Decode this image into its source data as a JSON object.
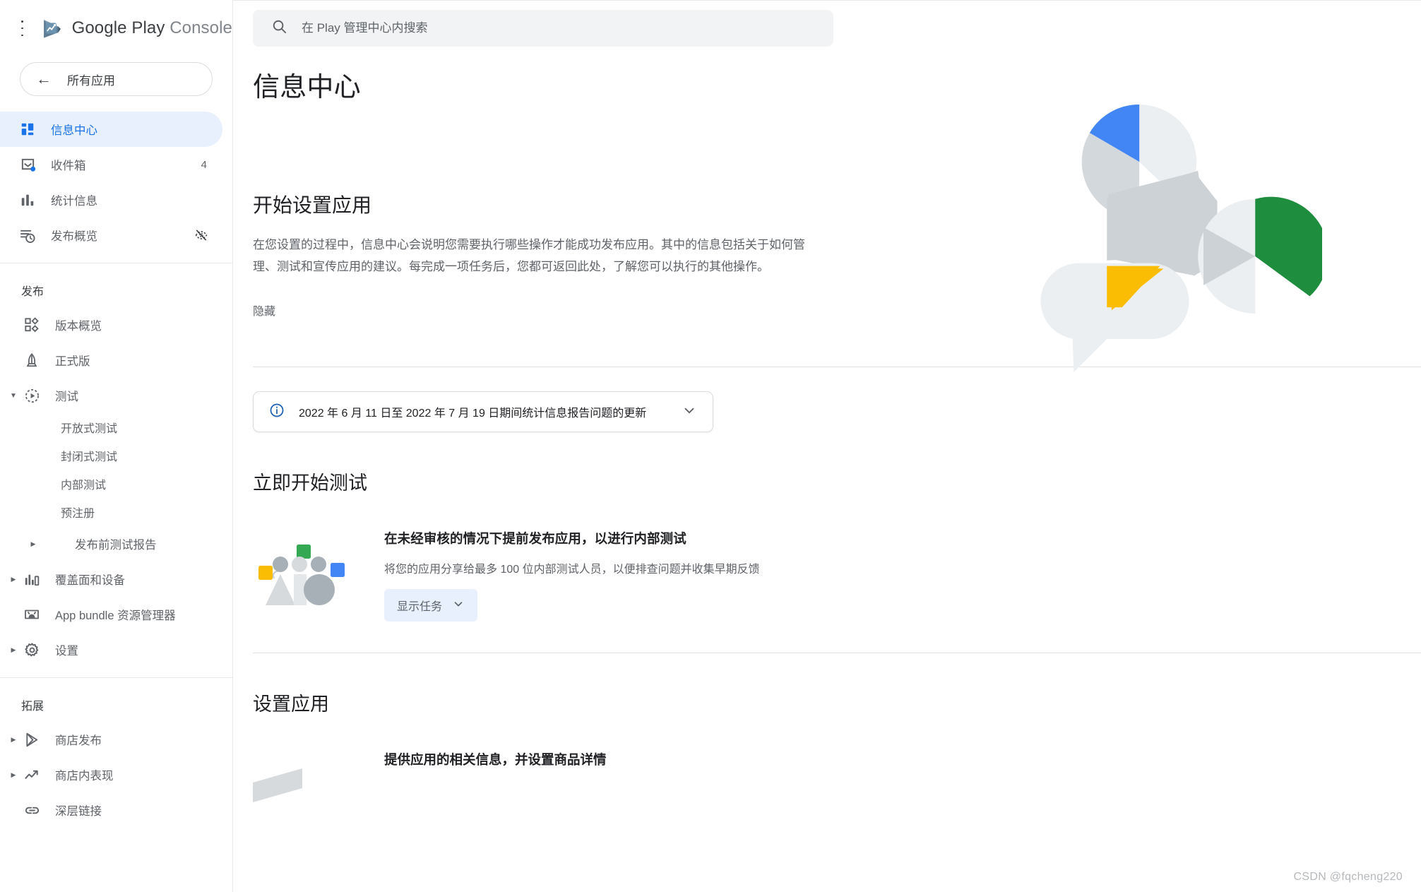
{
  "brand": {
    "name_primary": "Google Play",
    "name_secondary": "Console",
    "logo_icon": "google-play-icon",
    "menu_icon": "hamburger-menu-icon"
  },
  "sidebar": {
    "all_apps_button": {
      "label": "所有应用",
      "icon": "back-arrow-icon"
    },
    "top_items": [
      {
        "label": "信息中心",
        "icon": "dashboard-icon",
        "active": true,
        "badge": "",
        "trailing_icon": ""
      },
      {
        "label": "收件箱",
        "icon": "inbox-icon",
        "active": false,
        "badge": "4",
        "trailing_icon": ""
      },
      {
        "label": "统计信息",
        "icon": "bar-chart-icon",
        "active": false,
        "badge": "",
        "trailing_icon": ""
      },
      {
        "label": "发布概览",
        "icon": "publishing-overview-icon",
        "active": false,
        "badge": "",
        "trailing_icon": "visibility-off-icon"
      }
    ],
    "publish_section": {
      "title": "发布",
      "items": [
        {
          "label": "版本概览",
          "icon": "releases-overview-icon",
          "caret": "none"
        },
        {
          "label": "正式版",
          "icon": "rocket-icon",
          "caret": "none"
        },
        {
          "label": "测试",
          "icon": "testing-icon",
          "caret": "open"
        }
      ],
      "test_sub_items": [
        {
          "label": "开放式测试"
        },
        {
          "label": "封闭式测试"
        },
        {
          "label": "内部测试"
        },
        {
          "label": "预注册"
        }
      ],
      "items_after": [
        {
          "label": "发布前测试报告",
          "icon": "none",
          "caret": "closed",
          "indent": true
        },
        {
          "label": "覆盖面和设备",
          "icon": "reach-devices-icon",
          "caret": "closed",
          "indent": false
        },
        {
          "label": "App bundle 资源管理器",
          "icon": "android-bundle-icon",
          "caret": "none",
          "indent": false
        },
        {
          "label": "设置",
          "icon": "gear-icon",
          "caret": "closed",
          "indent": false
        }
      ]
    },
    "grow_section": {
      "title": "拓展",
      "items": [
        {
          "label": "商店发布",
          "icon": "store-presence-icon",
          "caret": "closed"
        },
        {
          "label": "商店内表现",
          "icon": "trending-up-icon",
          "caret": "closed"
        },
        {
          "label": "深层链接",
          "icon": "link-icon",
          "caret": "none"
        }
      ]
    }
  },
  "search": {
    "placeholder": "在 Play 管理中心内搜索",
    "value": "",
    "icon": "search-icon"
  },
  "page": {
    "title": "信息中心"
  },
  "hero": {
    "heading": "开始设置应用",
    "paragraph": "在您设置的过程中，信息中心会说明您需要执行哪些操作才能成功发布应用。其中的信息包括关于如何管理、测试和宣传应用的建议。每完成一项任务后，您都可返回此处，了解您可以执行的其他操作。",
    "hide_label": "隐藏",
    "illustration": "play-console-hero-illustration"
  },
  "info_banner": {
    "icon": "info-circle-icon",
    "text": "2022 年 6 月 11 日至 2022 年 7 月 19 日期间统计信息报告问题的更新",
    "expand_icon": "chevron-down-icon"
  },
  "testing_section": {
    "heading": "立即开始测试",
    "task": {
      "illustration": "internal-testers-illustration",
      "title": "在未经审核的情况下提前发布应用，以进行内部测试",
      "description": "将您的应用分享给最多 100 位内部测试人员，以便排查问题并收集早期反馈",
      "button_label": "显示任务",
      "button_icon": "chevron-down-icon"
    }
  },
  "setup_section": {
    "heading": "设置应用",
    "task": {
      "illustration": "store-listing-illustration",
      "title": "提供应用的相关信息，并设置商品详情"
    }
  },
  "watermark": {
    "text": "CSDN @fqcheng220"
  },
  "colors": {
    "blue": "#1a73e8",
    "blue_light": "#e8f0fe",
    "green": "#1e8e3e",
    "yellow": "#fbbc04",
    "play_blue": "#4285f4",
    "grey_text": "#5f6368",
    "dark_text": "#202124"
  }
}
